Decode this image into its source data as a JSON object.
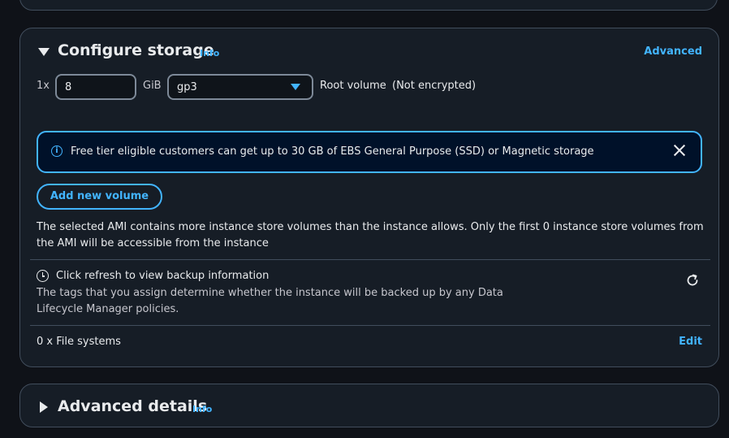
{
  "storage": {
    "title": "Configure storage",
    "info_label": "Info",
    "advanced_label": "Advanced",
    "volume_count": "1x",
    "size_value": "8",
    "size_unit": "GiB",
    "volume_type": "gp3",
    "root_volume_label": "Root volume",
    "encryption_label": "(Not encrypted)",
    "alert_text": "Free tier eligible customers can get up to 30 GB of EBS General Purpose (SSD) or Magnetic storage",
    "add_volume_label": "Add new volume",
    "ami_notice": "The selected AMI contains more instance store volumes than the instance allows. Only the first 0 instance store volumes from the AMI will be accessible from the instance",
    "backup_title": "Click refresh to view backup information",
    "backup_description": "The tags that you assign determine whether the instance will be backed up by any Data Lifecycle Manager policies.",
    "file_systems_label": "0 x File systems",
    "edit_label": "Edit"
  },
  "advanced_details": {
    "title": "Advanced details",
    "info_label": "Info"
  },
  "colors": {
    "accent": "#42b4ff",
    "background": "#0f1218",
    "panel": "#161d26",
    "border": "#414d5c"
  }
}
